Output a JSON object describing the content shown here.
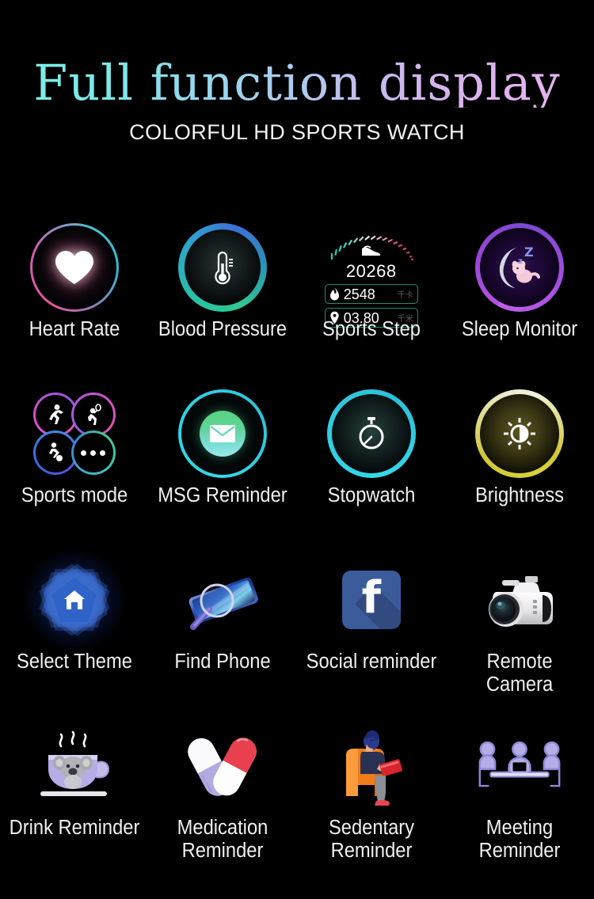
{
  "header": {
    "title": "Full function display",
    "subtitle": "COLORFUL HD SPORTS WATCH",
    "title_gradient_from": "#7df3ec",
    "title_gradient_to": "#e7b6ef",
    "background": "#000000"
  },
  "features": [
    {
      "id": "heart-rate",
      "label": "Heart Rate",
      "icon": "heart-icon",
      "ring_colors": [
        "#e8579b",
        "#49c7d8"
      ]
    },
    {
      "id": "blood-pressure",
      "label": "Blood Pressure",
      "icon": "thermometer-icon",
      "ring_colors": [
        "#2ec98e",
        "#3f6fd6"
      ]
    },
    {
      "id": "sports-step",
      "label": "Sports Step",
      "icon": "step-gauge-icon",
      "ring_colors": [
        "#2ec9b0",
        "#d6455a"
      ]
    },
    {
      "id": "sleep-monitor",
      "label": "Sleep Monitor",
      "icon": "moon-sleep-icon",
      "ring_colors": [
        "#b152e0",
        "#7a49cf"
      ]
    },
    {
      "id": "sports-mode",
      "label": "Sports mode",
      "icon": "sports-quad-icon",
      "ring_colors": [
        "#e255b7",
        "#43c98a"
      ]
    },
    {
      "id": "msg-reminder",
      "label": "MSG Reminder",
      "icon": "envelope-icon",
      "ring_colors": [
        "#2fd8e8",
        "#57d27e"
      ]
    },
    {
      "id": "stopwatch",
      "label": "Stopwatch",
      "icon": "stopwatch-icon",
      "ring_colors": [
        "#2fd8e8",
        "#2bc0d8"
      ]
    },
    {
      "id": "brightness",
      "label": "Brightness",
      "icon": "sun-half-icon",
      "ring_colors": [
        "#d8d23a",
        "#f3f1e0"
      ]
    },
    {
      "id": "select-theme",
      "label": "Select Theme",
      "icon": "home-flower-icon",
      "ring_colors": [
        "#2f63c8",
        "#12356f"
      ]
    },
    {
      "id": "find-phone",
      "label": "Find Phone",
      "icon": "phone-search-icon",
      "ring_colors": [
        "#2e55b8",
        "#8d86d8"
      ]
    },
    {
      "id": "social-reminder",
      "label": "Social reminder",
      "icon": "facebook-icon",
      "ring_colors": [
        "#3b5b9b",
        "#ffffff"
      ]
    },
    {
      "id": "remote-camera",
      "label": "Remote Camera",
      "icon": "camera-icon",
      "ring_colors": [
        "#e8e8e8",
        "#2b2b2b"
      ]
    },
    {
      "id": "drink-reminder",
      "label": "Drink Reminder",
      "icon": "coffee-koala-icon",
      "ring_colors": [
        "#b9b3e6",
        "#ffffff"
      ]
    },
    {
      "id": "medication-reminder",
      "label": "Medication Reminder",
      "icon": "pills-icon",
      "ring_colors": [
        "#b0abe0",
        "#e2465c"
      ]
    },
    {
      "id": "sedentary-reminder",
      "label": "Sedentary Reminder",
      "icon": "sitting-person-icon",
      "ring_colors": [
        "#f07c1a",
        "#2b3152"
      ]
    },
    {
      "id": "meeting-reminder",
      "label": "Meeting Reminder",
      "icon": "meeting-table-icon",
      "ring_colors": [
        "#b3aee8",
        "#8f89d4"
      ]
    }
  ],
  "sports_step_face": {
    "steps": "20268",
    "calories_value": "2548",
    "calories_unit": "千卡",
    "distance_value": "03.80",
    "distance_unit": "千米"
  }
}
